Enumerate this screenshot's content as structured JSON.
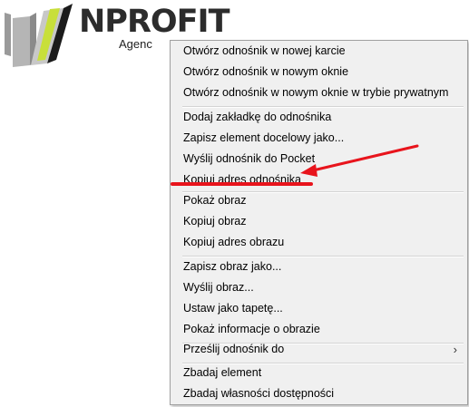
{
  "logo": {
    "name": "NPROFIT",
    "subtitle": "Agenc"
  },
  "context_menu": {
    "items": [
      {
        "label": "Otwórz odnośnik w nowej karcie"
      },
      {
        "label": "Otwórz odnośnik w nowym oknie"
      },
      {
        "label": "Otwórz odnośnik w nowym oknie w trybie prywatnym"
      },
      {
        "label": "Dodaj zakładkę do odnośnika"
      },
      {
        "label": "Zapisz element docelowy jako..."
      },
      {
        "label": "Wyślij odnośnik do Pocket"
      },
      {
        "label": "Kopiuj adres odnośnika"
      },
      {
        "label": "Pokaż obraz"
      },
      {
        "label": "Kopiuj obraz"
      },
      {
        "label": "Kopiuj adres obrazu"
      },
      {
        "label": "Zapisz obraz jako..."
      },
      {
        "label": "Wyślij obraz..."
      },
      {
        "label": "Ustaw jako tapetę..."
      },
      {
        "label": "Pokaż informacje o obrazie"
      },
      {
        "label": "Prześlij odnośnik do"
      },
      {
        "label": "Zbadaj element"
      },
      {
        "label": "Zbadaj własności dostępności"
      }
    ],
    "submenu_arrow": "›"
  },
  "colors": {
    "annotation": "#e8141c",
    "menu_background": "#f0f0f0",
    "menu_border": "#a0a0a0"
  }
}
